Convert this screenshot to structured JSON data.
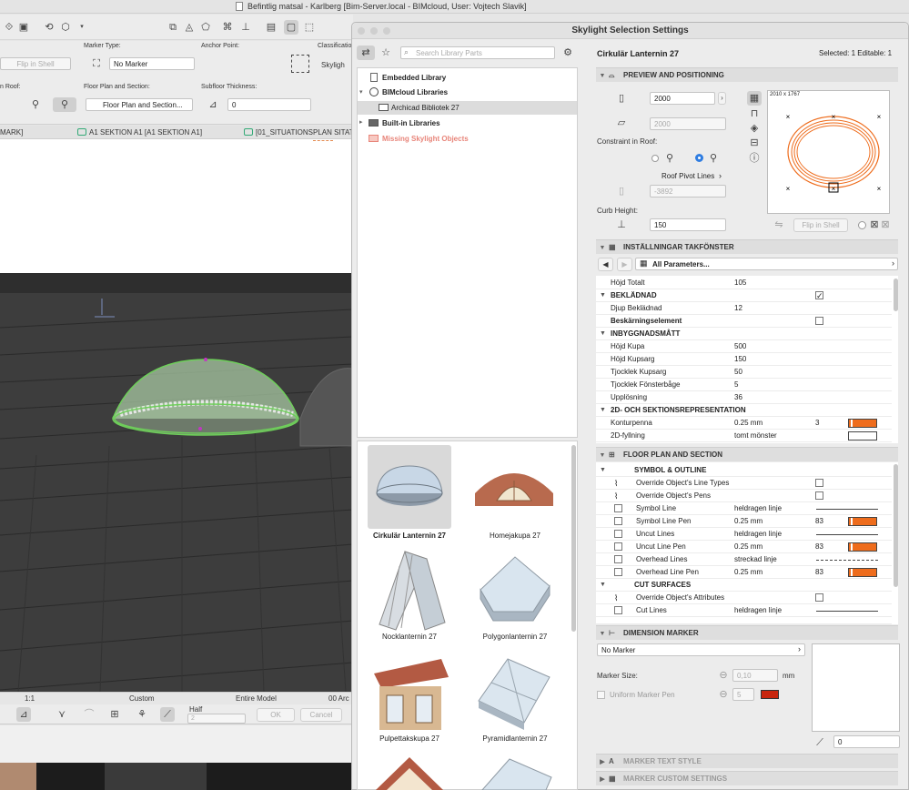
{
  "app": {
    "title": "Befintlig matsal - Karlberg [Bim-Server.local - BIMcloud, User: Vojtech Slavik]"
  },
  "bg": {
    "marker_type_label": "Marker Type:",
    "marker_type_value": "No Marker",
    "anchor_point_label": "Anchor Point:",
    "classification_label": "Classification",
    "classification_value": "Skyligh",
    "flip_in_shell": "Flip in Shell",
    "roof_label": "n Roof:",
    "fp_section_label": "Floor Plan and Section:",
    "fp_section_value": "Floor Plan and Section...",
    "subfloor_label": "Subfloor Thickness:",
    "subfloor_value": "0",
    "tab1": "MARK]",
    "tab2": "A1 SEKTION A1 [A1 SEKTION A1]",
    "tab3": "[01_SITUATIONSPLAN SITAT",
    "scale": "1:1",
    "custom": "Custom",
    "entire_model": "Entire Model",
    "arc": "00 Arc",
    "half": "Half",
    "half_val": "2",
    "ok": "OK",
    "cancel": "Cancel"
  },
  "dialog": {
    "title": "Skylight Selection Settings",
    "search_placeholder": "Search Library Parts",
    "selected_name": "Cirkulär Lanternin 27",
    "selected_info": "Selected: 1 Editable: 1",
    "tree": [
      {
        "label": "Embedded Library"
      },
      {
        "label": "BIMcloud Libraries"
      },
      {
        "label": "Archicad Bibliotek 27"
      },
      {
        "label": "Built-in Libraries"
      },
      {
        "label": "Missing Skylight Objects"
      }
    ],
    "gallery": [
      {
        "label": "Cirkulär Lanternin 27"
      },
      {
        "label": "Homejakupa 27"
      },
      {
        "label": "Nocklanternin 27"
      },
      {
        "label": "Polygonlanternin 27"
      },
      {
        "label": "Pulpettakskupa 27"
      },
      {
        "label": "Pyramidlanternin 27"
      }
    ],
    "preview": {
      "header": "PREVIEW AND POSITIONING",
      "width": "2000",
      "height": "2000",
      "constraint_label": "Constraint in Roof:",
      "roof_pivot": "Roof Pivot Lines",
      "offset": "-3892",
      "curb_label": "Curb Height:",
      "curb_value": "150",
      "dims": "2010 x 1767",
      "flip": "Flip in Shell"
    },
    "params": {
      "header": "INSTÄLLNINGAR TAKFÖNSTER",
      "nav_value": "All Parameters...",
      "rows": [
        {
          "name": "Höjd Totalt",
          "value": "105"
        },
        {
          "name": "BEKLÄDNAD"
        },
        {
          "name": "Djup Beklädnad",
          "value": "12"
        },
        {
          "name": "Beskärningselement"
        },
        {
          "name": "INBYGGNADSMÅTT"
        },
        {
          "name": "Höjd Kupa",
          "value": "500"
        },
        {
          "name": "Höjd Kupsarg",
          "value": "150"
        },
        {
          "name": "Tjocklek Kupsarg",
          "value": "50"
        },
        {
          "name": "Tjocklek Fönsterbåge",
          "value": "5"
        },
        {
          "name": "Upplösning",
          "value": "36"
        },
        {
          "name": "2D- OCH SEKTIONSREPRESENTATION"
        },
        {
          "name": "Konturpenna",
          "value": "0.25 mm",
          "pen": "3"
        },
        {
          "name": "2D-fyllning",
          "value": "tomt mönster"
        }
      ]
    },
    "floor": {
      "header": "FLOOR PLAN AND SECTION",
      "symbol_group": "SYMBOL & OUTLINE",
      "rows": [
        {
          "name": "Override Object's Line Types"
        },
        {
          "name": "Override Object's Pens"
        },
        {
          "name": "Symbol Line",
          "value": "heldragen linje"
        },
        {
          "name": "Symbol Line Pen",
          "value": "0.25 mm",
          "pen": "83"
        },
        {
          "name": "Uncut Lines",
          "value": "heldragen linje"
        },
        {
          "name": "Uncut Line Pen",
          "value": "0.25 mm",
          "pen": "83"
        },
        {
          "name": "Overhead Lines",
          "value": "streckad linje"
        },
        {
          "name": "Overhead Line Pen",
          "value": "0.25 mm",
          "pen": "83"
        }
      ],
      "cut_group": "CUT SURFACES",
      "cut_rows": [
        {
          "name": "Override Object's Attributes"
        },
        {
          "name": "Cut Lines",
          "value": "heldragen linje"
        }
      ]
    },
    "dimension": {
      "header": "DIMENSION MARKER",
      "marker": "No Marker",
      "size_label": "Marker Size:",
      "size_value": "0,10",
      "size_unit": "mm",
      "pen_label": "Uniform Marker Pen",
      "pen_value": "5",
      "angle_value": "0"
    },
    "text_style": "MARKER TEXT STYLE",
    "custom": "MARKER CUSTOM SETTINGS"
  },
  "colors": {
    "pen_orange": "#ee6c1c",
    "dome_green": "#6ecf5a",
    "missing_red": "#e8857a"
  }
}
